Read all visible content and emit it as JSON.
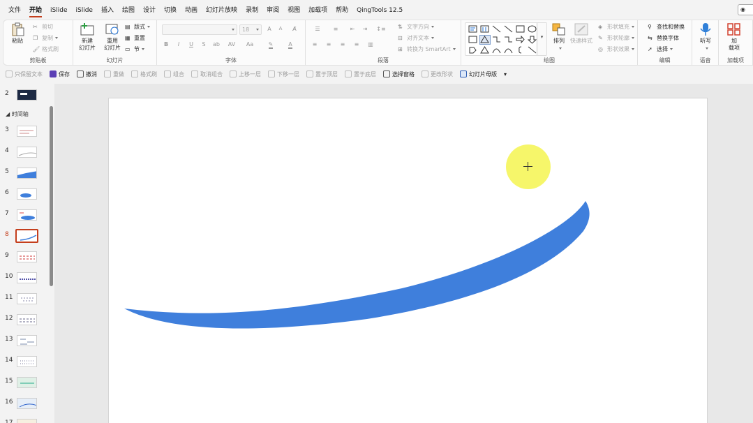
{
  "menu": {
    "items": [
      "文件",
      "开始",
      "iSlide",
      "iSlide",
      "插入",
      "绘图",
      "设计",
      "切换",
      "动画",
      "幻灯片放映",
      "录制",
      "审阅",
      "视图",
      "加载项",
      "帮助",
      "QingTools 12.5"
    ],
    "active_index": 1
  },
  "ribbon": {
    "clipboard": {
      "paste": "粘贴",
      "cut": "剪切",
      "copy": "复制",
      "format_painter": "格式刷",
      "label": "剪贴板"
    },
    "slides": {
      "new_slide": "新建",
      "new_slide_2": "幻灯片",
      "reuse": "重用",
      "reuse_2": "幻灯片",
      "layout": "版式",
      "reset": "重置",
      "section": "节",
      "label": "幻灯片"
    },
    "font": {
      "size": "18",
      "label": "字体",
      "bold": "B",
      "italic": "I",
      "underline": "U",
      "strike": "S",
      "spacing": "AV",
      "case": "Aa",
      "grow": "A",
      "shrink": "A"
    },
    "paragraph": {
      "text_direction": "文字方向",
      "align_text": "对齐文本",
      "smartart": "转换为 SmartArt",
      "label": "段落"
    },
    "drawing": {
      "arrange": "排列",
      "quick_styles": "快速样式",
      "shape_fill": "形状填充",
      "shape_outline": "形状轮廓",
      "shape_effects": "形状效果",
      "label": "绘图"
    },
    "editing": {
      "find_replace": "查找和替换",
      "replace_font": "替换字体",
      "select": "选择",
      "label": "编辑"
    },
    "voice": {
      "dictate": "听写",
      "label": "语音"
    },
    "addins": {
      "addin": "加",
      "addin_2": "载项",
      "label": "加载项"
    }
  },
  "qat": {
    "items": [
      {
        "label": "只保留文本",
        "on": false
      },
      {
        "label": "保存",
        "on": true
      },
      {
        "label": "撤消",
        "on": true
      },
      {
        "label": "重做",
        "on": false
      },
      {
        "label": "格式刷",
        "on": false
      },
      {
        "label": "组合",
        "on": false
      },
      {
        "label": "取消组合",
        "on": false
      },
      {
        "label": "上移一层",
        "on": false
      },
      {
        "label": "下移一层",
        "on": false
      },
      {
        "label": "置于顶层",
        "on": false
      },
      {
        "label": "置于底层",
        "on": false
      },
      {
        "label": "选择窗格",
        "on": true
      },
      {
        "label": "更改形状",
        "on": false
      },
      {
        "label": "幻灯片母版",
        "on": true
      }
    ]
  },
  "slides_panel": {
    "section_name": "时间轴",
    "selected": "8",
    "numbers": [
      "2",
      "3",
      "4",
      "5",
      "6",
      "7",
      "8",
      "9",
      "10",
      "11",
      "12",
      "13",
      "14",
      "15",
      "16",
      "17"
    ]
  },
  "colors": {
    "accent": "#c43e1c",
    "stroke_blue": "#3f7fdc",
    "cursor_halo": "#f5f550"
  }
}
